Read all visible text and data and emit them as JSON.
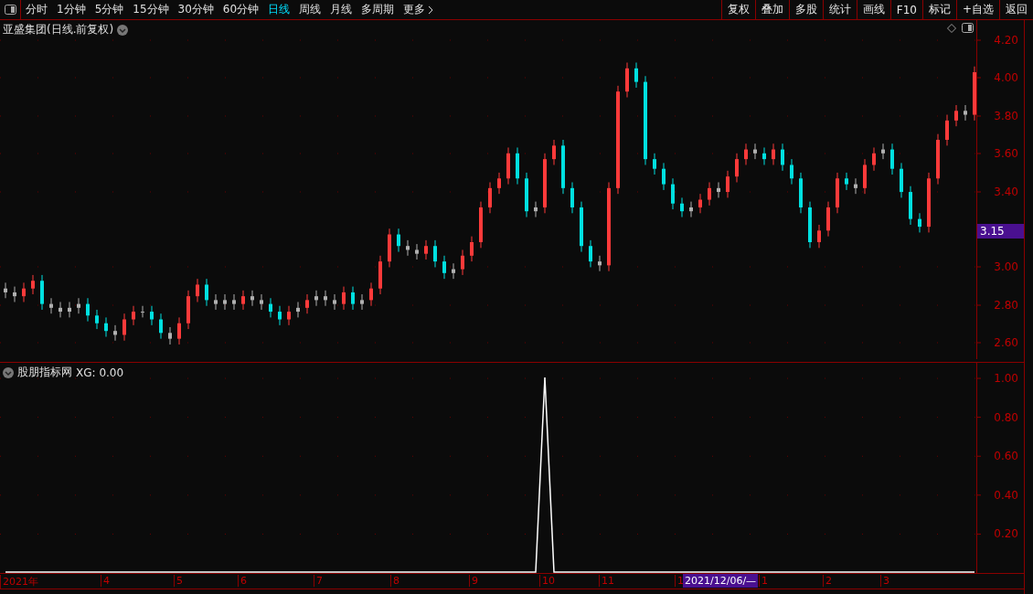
{
  "toolbar": {
    "periods": [
      {
        "label": "分时",
        "selected": false
      },
      {
        "label": "1分钟",
        "selected": false
      },
      {
        "label": "5分钟",
        "selected": false
      },
      {
        "label": "15分钟",
        "selected": false
      },
      {
        "label": "30分钟",
        "selected": false
      },
      {
        "label": "60分钟",
        "selected": false
      },
      {
        "label": "日线",
        "selected": true
      },
      {
        "label": "周线",
        "selected": false
      },
      {
        "label": "月线",
        "selected": false
      },
      {
        "label": "多周期",
        "selected": false
      },
      {
        "label": "更多",
        "selected": false
      }
    ],
    "actions": [
      "复权",
      "叠加",
      "多股",
      "统计",
      "画线",
      "F10",
      "标记",
      "+自选",
      "返回"
    ]
  },
  "price_panel": {
    "title": "亚盛集团(日线.前复权)",
    "axis_labels": [
      "4.20",
      "4.00",
      "3.80",
      "3.60",
      "3.40",
      "3.00",
      "2.80",
      "2.60"
    ],
    "price_marker": "3.15"
  },
  "indicator_panel": {
    "title": "股朋指标网",
    "reading": "XG: 0.00",
    "chart_data": {
      "type": "line",
      "grid": true,
      "ylim": [
        0,
        1.08
      ],
      "yticks": [
        {
          "value": 0.2,
          "label": "0.20"
        },
        {
          "value": 0.4,
          "label": "0.40"
        },
        {
          "value": 0.6,
          "label": "0.60"
        },
        {
          "value": 0.8,
          "label": "0.80"
        },
        {
          "value": 1.0,
          "label": "1.00"
        }
      ],
      "series": [
        {
          "color": "#ffffff",
          "values": [
            0,
            0,
            0,
            0,
            0,
            0,
            0,
            0,
            0,
            0,
            0,
            0,
            0,
            0,
            0,
            0,
            0,
            0,
            0,
            0,
            0,
            0,
            0,
            0,
            0,
            0,
            0,
            0,
            0,
            0,
            0,
            0,
            0,
            0,
            0,
            0,
            0,
            0,
            0,
            0,
            0,
            0,
            0,
            0,
            0,
            0,
            0,
            0,
            0,
            0,
            0,
            0,
            0,
            0,
            0,
            0,
            0,
            0,
            0,
            1,
            0,
            0,
            0,
            0,
            0,
            0,
            0,
            0,
            0,
            0,
            0,
            0,
            0,
            0,
            0,
            0,
            0,
            0,
            0,
            0,
            0,
            0,
            0,
            0,
            0,
            0,
            0,
            0,
            0,
            0,
            0,
            0,
            0,
            0,
            0,
            0,
            0,
            0,
            0,
            0,
            0,
            0,
            0,
            0,
            0,
            0,
            0
          ]
        }
      ]
    }
  },
  "date_axis": {
    "labels": [
      "2021年",
      "4",
      "5",
      "6",
      "7",
      "8",
      "9",
      "10",
      "11",
      "1",
      "1",
      "2",
      "3"
    ],
    "cursor": "2021/12/06/—"
  }
}
